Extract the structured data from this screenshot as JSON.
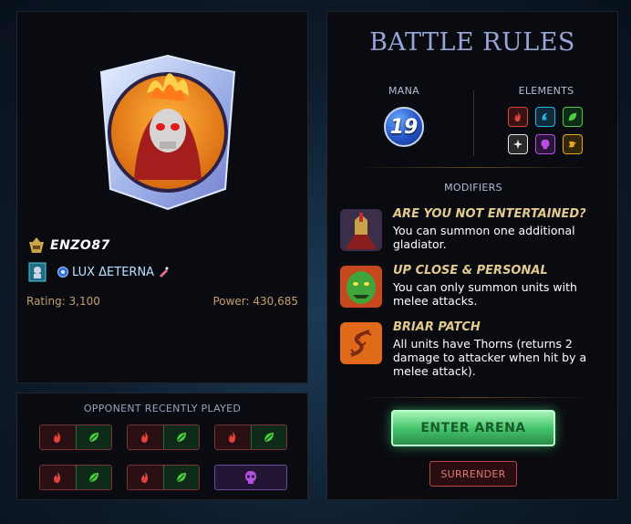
{
  "player": {
    "name": "ENZO87",
    "guild": "LUX ΔETERNA",
    "rating": "Rating: 3,100",
    "power": "Power: 430,685"
  },
  "opponent": {
    "title": "OPPONENT RECENTLY PLAYED",
    "recent": [
      [
        "fire",
        "earth"
      ],
      [
        "fire",
        "earth"
      ],
      [
        "fire",
        "earth"
      ],
      [
        "fire",
        "earth"
      ],
      [
        "fire",
        "earth"
      ],
      [
        "death"
      ]
    ]
  },
  "rules": {
    "title": "BATTLE RULES",
    "mana_label": "MANA",
    "mana_value": "19",
    "elements_label": "ELEMENTS",
    "elements": [
      "fire",
      "water",
      "earth",
      "life",
      "death",
      "dragon"
    ],
    "modifiers_label": "MODIFIERS",
    "modifiers": [
      {
        "title": "ARE YOU NOT ENTERTAINED?",
        "desc": "You can summon one additional gladiator.",
        "icon": "gladiator-helmet-icon"
      },
      {
        "title": "UP CLOSE & PERSONAL",
        "desc": "You can only summon units with melee attacks.",
        "icon": "goblin-face-icon"
      },
      {
        "title": "BRIAR PATCH",
        "desc": "All units have Thorns (returns 2 damage to attacker when hit by a melee attack).",
        "icon": "thorns-icon"
      }
    ],
    "enter_label": "ENTER ARENA",
    "surrender_label": "SURRENDER"
  },
  "colors": {
    "fire": "#e0443a",
    "water": "#2ab0e6",
    "earth": "#4ccf3f",
    "life": "#e8e8e8",
    "death": "#b44fe0",
    "dragon": "#e6a91e",
    "accent_gold": "#e2c98d"
  }
}
